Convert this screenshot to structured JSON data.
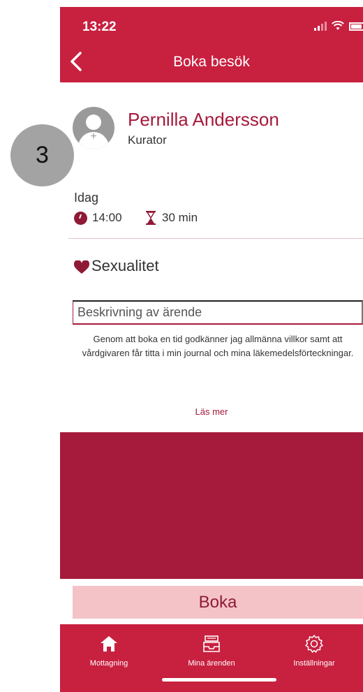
{
  "status_bar": {
    "time": "13:22"
  },
  "nav": {
    "title": "Boka besök"
  },
  "profile": {
    "name": "Pernilla Andersson",
    "role": "Kurator"
  },
  "appointment": {
    "day": "Idag",
    "time": "14:00",
    "duration": "30 min"
  },
  "category": {
    "label": "Sexualitet"
  },
  "description": {
    "placeholder": "Beskrivning av ärende"
  },
  "terms": {
    "text": "Genom att boka en tid godkänner jag allmänna villkor samt att vårdgivaren får titta i min journal och mina läkemedelsförteckningar.",
    "more_link": "Läs mer"
  },
  "book_button": "Boka",
  "tabs": [
    {
      "label": "Mottagning",
      "icon": "home-icon"
    },
    {
      "label": "Mina ärenden",
      "icon": "inbox-tray-icon"
    },
    {
      "label": "Inställningar",
      "icon": "gear-icon"
    }
  ],
  "step_badge": "3",
  "colors": {
    "primary": "#c8203f",
    "dark": "#a61a3c",
    "button_bg": "#f4c3c8",
    "text_accent": "#a6193a"
  }
}
